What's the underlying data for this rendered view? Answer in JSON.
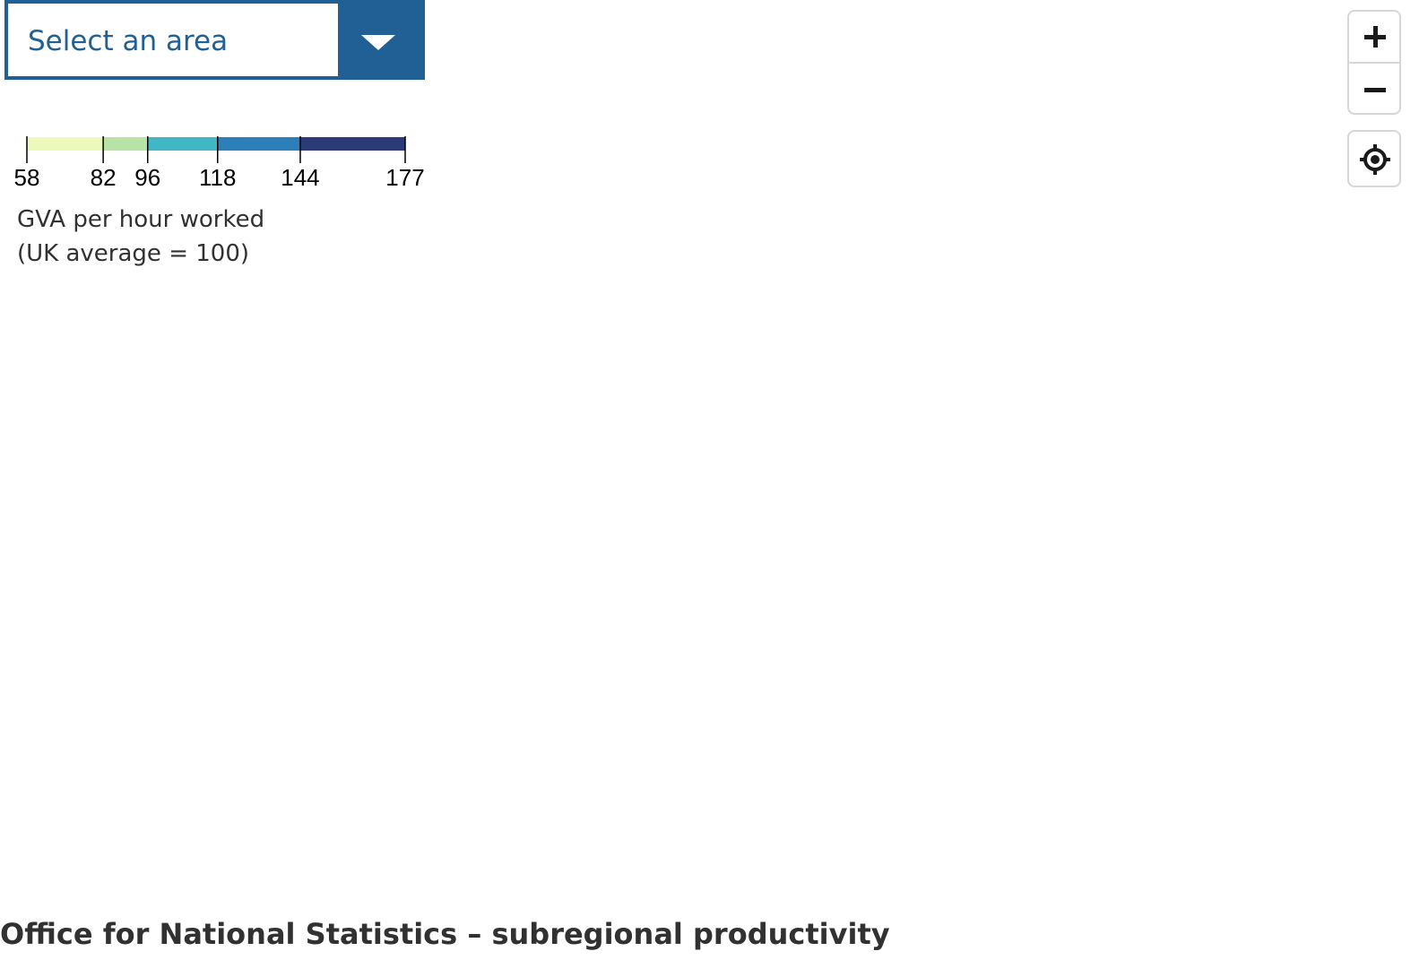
{
  "area_select": {
    "label": "Select an area",
    "accent_color": "#206095"
  },
  "legend": {
    "title_line1": "GVA per hour worked",
    "title_line2": "(UK average = 100)",
    "breaks": [
      58,
      82,
      96,
      118,
      144,
      177
    ],
    "tick_labels": [
      "58",
      "82",
      "96",
      "118",
      "144",
      "177"
    ],
    "colors": [
      "#edf8bb",
      "#b7e3a6",
      "#41b6c4",
      "#2c7fb8",
      "#2c3b78"
    ]
  },
  "controls": {
    "zoom_in_icon": "plus-icon",
    "zoom_out_icon": "minus-icon",
    "locate_icon": "crosshair-icon"
  },
  "footer": {
    "source": "Office for National Statistics – subregional productivity"
  }
}
